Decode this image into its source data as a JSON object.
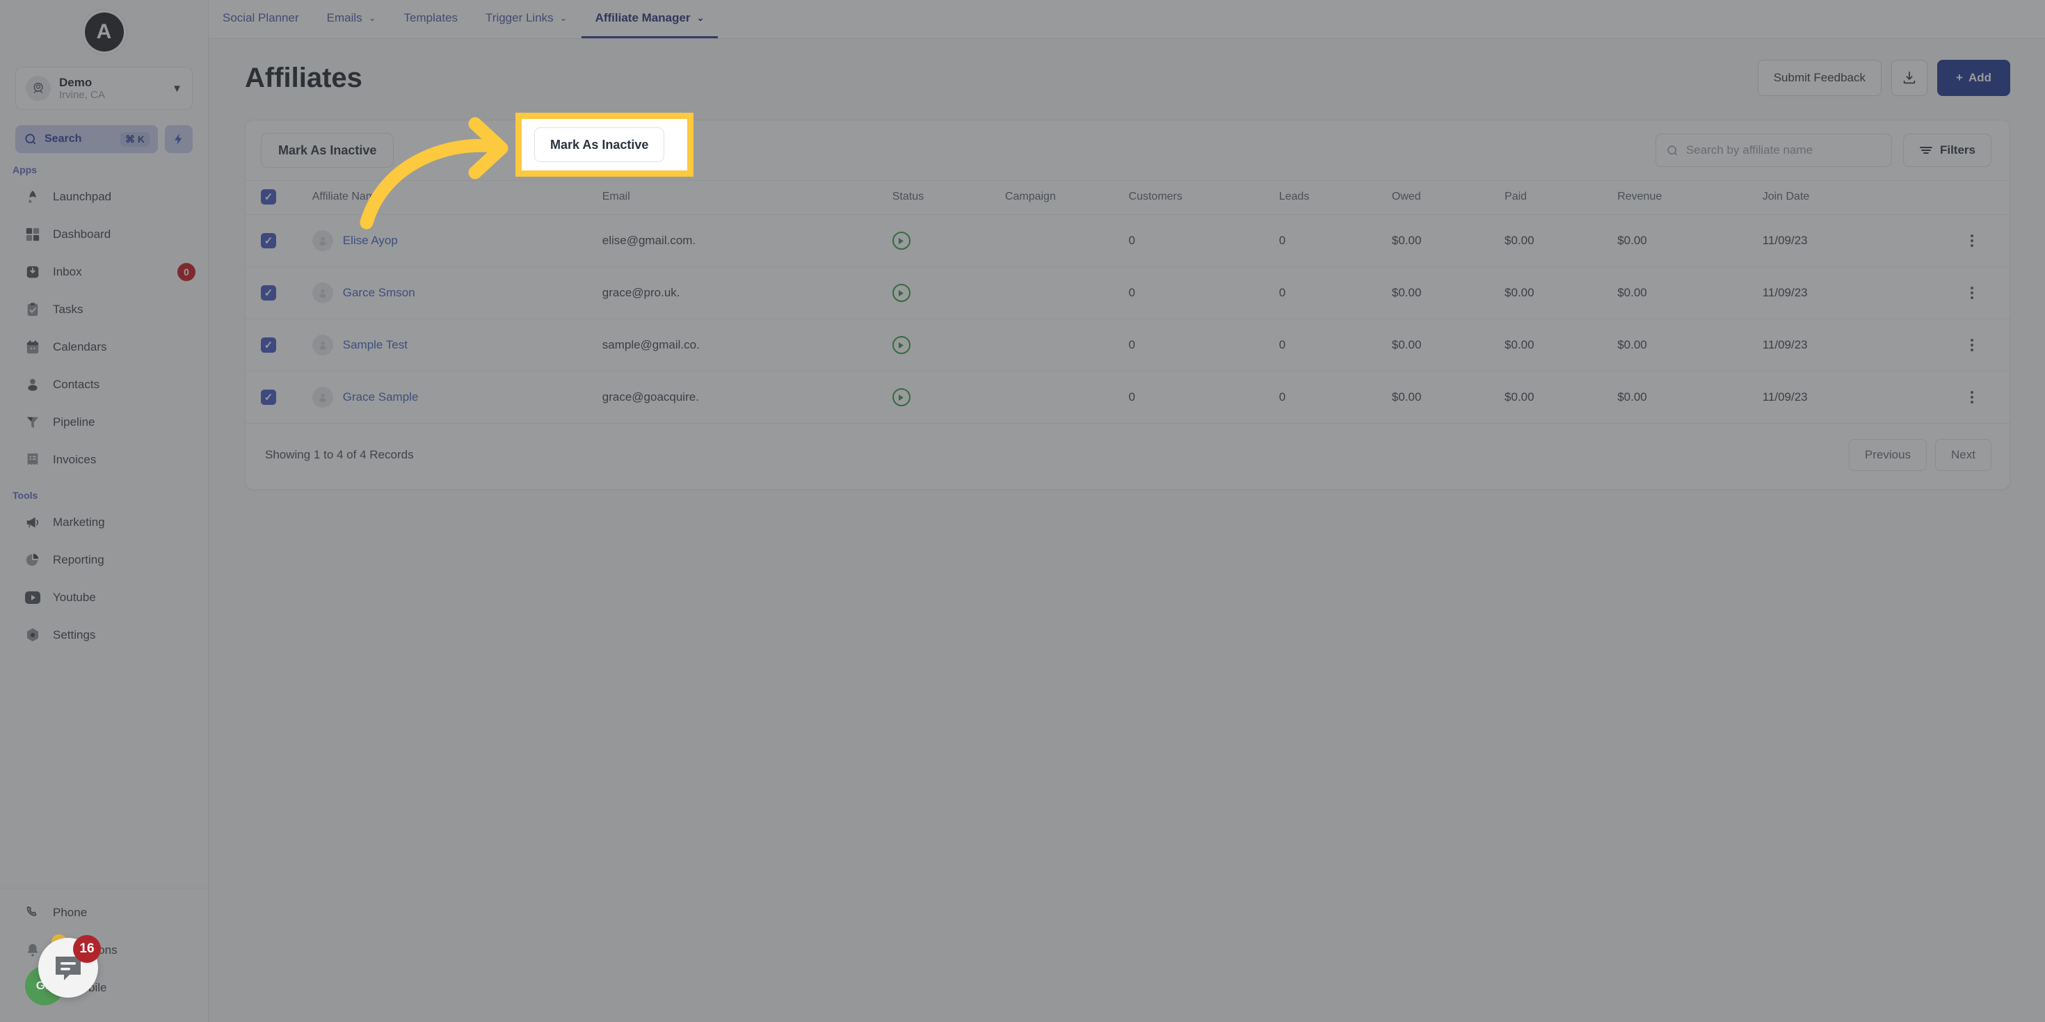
{
  "sidebar": {
    "logo_letter": "A",
    "location": {
      "name": "Demo",
      "sub": "Irvine, CA",
      "icon": "location-pin-icon",
      "chevron": "chevron-down-icon"
    },
    "search": {
      "label": "Search",
      "shortcut": "⌘ K",
      "icon": "search-icon"
    },
    "quick_action_icon": "lightning-bolt-icon",
    "sections": [
      {
        "title": "Apps",
        "items": [
          {
            "label": "Launchpad",
            "icon": "rocket-icon",
            "badge": ""
          },
          {
            "label": "Dashboard",
            "icon": "grid-icon",
            "badge": ""
          },
          {
            "label": "Inbox",
            "icon": "inbox-icon",
            "badge": "0"
          },
          {
            "label": "Tasks",
            "icon": "clipboard-check-icon",
            "badge": ""
          },
          {
            "label": "Calendars",
            "icon": "calendar-icon",
            "badge": ""
          },
          {
            "label": "Contacts",
            "icon": "person-icon",
            "badge": ""
          },
          {
            "label": "Pipeline",
            "icon": "funnel-icon",
            "badge": ""
          },
          {
            "label": "Invoices",
            "icon": "invoice-icon",
            "badge": ""
          }
        ]
      },
      {
        "title": "Tools",
        "items": [
          {
            "label": "Marketing",
            "icon": "megaphone-icon",
            "badge": ""
          },
          {
            "label": "Reporting",
            "icon": "pie-chart-icon",
            "badge": ""
          },
          {
            "label": "Youtube",
            "icon": "youtube-icon",
            "badge": ""
          },
          {
            "label": "Settings",
            "icon": "gear-icon",
            "badge": ""
          }
        ]
      }
    ],
    "bottom_items": [
      {
        "label": "Phone",
        "icon": "phone-icon"
      },
      {
        "label": "Notifications",
        "icon": "bell-icon"
      },
      {
        "label": "Go Mobile",
        "icon": "mobile-icon"
      }
    ]
  },
  "topbar": {
    "menu_icon": "hamburger-menu-icon",
    "tabs": [
      {
        "label": "Social Planner",
        "caret": "",
        "active": false
      },
      {
        "label": "Emails",
        "caret": "⌄",
        "active": false
      },
      {
        "label": "Templates",
        "caret": "",
        "active": false
      },
      {
        "label": "Trigger Links",
        "caret": "⌄",
        "active": false
      },
      {
        "label": "Affiliate Manager",
        "caret": "⌄",
        "active": true
      }
    ]
  },
  "header": {
    "title": "Affiliates",
    "submit_feedback_label": "Submit Feedback",
    "download_icon": "download-icon",
    "add_label": "Add",
    "add_icon": "plus-icon"
  },
  "toolbar": {
    "mark_inactive_label": "Mark As Inactive",
    "search_placeholder": "Search by affiliate name",
    "search_icon": "search-icon",
    "filters_label": "Filters",
    "filters_icon": "filter-icon"
  },
  "table": {
    "select_all_checked": true,
    "columns": [
      "Affiliate Name",
      "Email",
      "Status",
      "Campaign",
      "Customers",
      "Leads",
      "Owed",
      "Paid",
      "Revenue",
      "Join Date"
    ],
    "rows": [
      {
        "checked": true,
        "name": "Elise Ayop",
        "email": "elise@gmail.com.",
        "status": "active",
        "campaign": "",
        "customers": "0",
        "leads": "0",
        "owed": "$0.00",
        "paid": "$0.00",
        "revenue": "$0.00",
        "join_date": "11/09/23"
      },
      {
        "checked": true,
        "name": "Garce Smson",
        "email": "grace@pro.uk.",
        "status": "active",
        "campaign": "",
        "customers": "0",
        "leads": "0",
        "owed": "$0.00",
        "paid": "$0.00",
        "revenue": "$0.00",
        "join_date": "11/09/23"
      },
      {
        "checked": true,
        "name": "Sample Test",
        "email": "sample@gmail.co.",
        "status": "active",
        "campaign": "",
        "customers": "0",
        "leads": "0",
        "owed": "$0.00",
        "paid": "$0.00",
        "revenue": "$0.00",
        "join_date": "11/09/23"
      },
      {
        "checked": true,
        "name": "Grace Sample",
        "email": "grace@goacquire.",
        "status": "active",
        "campaign": "",
        "customers": "0",
        "leads": "0",
        "owed": "$0.00",
        "paid": "$0.00",
        "revenue": "$0.00",
        "join_date": "11/09/23"
      }
    ],
    "row_menu_icon": "kebab-menu-icon"
  },
  "footer": {
    "records_text": "Showing 1 to 4 of 4 Records",
    "previous_label": "Previous",
    "next_label": "Next"
  },
  "annotation": {
    "highlight_target": "Mark As Inactive",
    "arrow_icon": "curved-arrow-right-icon",
    "highlight_color": "#fcc93f"
  },
  "chat_widget": {
    "icon": "chat-bubble-icon",
    "badge": "16",
    "secondary_label": "GP"
  }
}
